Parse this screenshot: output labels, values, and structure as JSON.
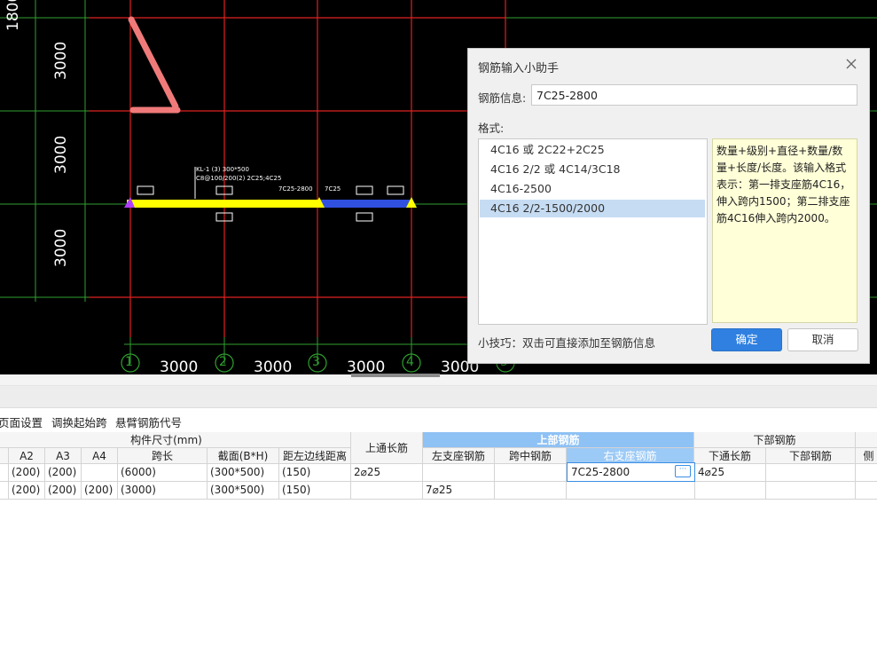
{
  "cad": {
    "side_dims": [
      "1800",
      "3000",
      "3000",
      "3000"
    ],
    "axis_labels": [
      "1",
      "2",
      "3",
      "4",
      "5"
    ],
    "bottom_dims": [
      "3000",
      "3000",
      "3000",
      "3000"
    ],
    "annotation_line1": "KL-1 (3) 300*500",
    "annotation_line2": "C8@100/200(2) 2C25;4C25",
    "small_label_1": "7C25-2800",
    "small_label_2": "7C25",
    "colors": {
      "background": "#000000",
      "grid_red": "#e02020",
      "grid_green": "#2fa02f",
      "beam_yellow": "#ffff00",
      "beam_blue": "#3050e0",
      "rebar_pink": "#f07a7a"
    }
  },
  "toolbar": {
    "items": [
      "页面设置",
      "调换起始跨",
      "悬臂钢筋代号"
    ]
  },
  "grid": {
    "group_headers": {
      "dims": "构件尺寸(mm)",
      "top": "上部钢筋",
      "bottom": "下部钢筋"
    },
    "columns": [
      "A2",
      "A3",
      "A4",
      "跨长",
      "截面(B*H)",
      "距左边线距离",
      "上通长筋",
      "左支座钢筋",
      "跨中钢筋",
      "右支座钢筋",
      "下通长筋",
      "下部钢筋",
      "侧"
    ],
    "rows": [
      [
        "(200)",
        "(200)",
        "",
        "(6000)",
        "(300*500)",
        "(150)",
        "2⌀25",
        "",
        "",
        "7C25-2800",
        "4⌀25",
        "",
        ""
      ],
      [
        "(200)",
        "(200)",
        "(200)",
        "(3000)",
        "(300*500)",
        "(150)",
        "",
        "7⌀25",
        "",
        "",
        "",
        "",
        ""
      ]
    ]
  },
  "dialog": {
    "title": "钢筋输入小助手",
    "rebar_info_label": "钢筋信息:",
    "rebar_info_value": "7C25-2800",
    "format_label": "格式:",
    "formats": [
      "4C16 或 2C22+2C25",
      "4C16 2/2 或 4C14/3C18",
      "4C16-2500",
      "4C16 2/2-1500/2000"
    ],
    "selected_format_index": 3,
    "description": "数量+级别+直径+数量/数量+长度/长度。该输入格式表示：第一排支座筋4C16，伸入跨内1500；第二排支座筋4C16伸入跨内2000。",
    "tip": "小技巧：双击可直接添加至钢筋信息",
    "ok_label": "确定",
    "cancel_label": "取消"
  }
}
